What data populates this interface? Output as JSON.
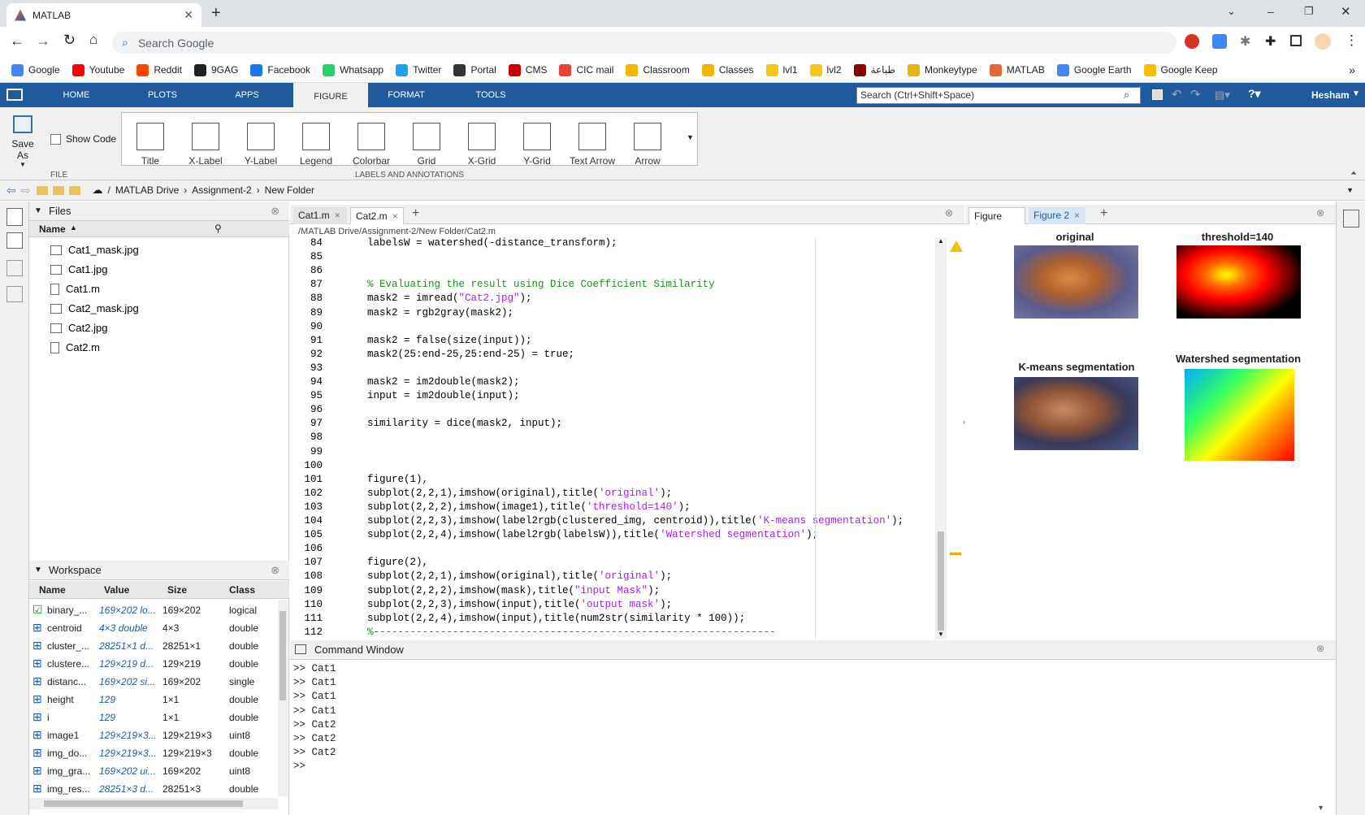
{
  "browser": {
    "tab_title": "MATLAB",
    "search_placeholder": "Search Google",
    "bookmarks": [
      {
        "label": "Google",
        "color": "#4285f4"
      },
      {
        "label": "Youtube",
        "color": "#ff0000"
      },
      {
        "label": "Reddit",
        "color": "#ff4500"
      },
      {
        "label": "9GAG",
        "color": "#222222"
      },
      {
        "label": "Facebook",
        "color": "#1877f2"
      },
      {
        "label": "Whatsapp",
        "color": "#25d366"
      },
      {
        "label": "Twitter",
        "color": "#1da1f2"
      },
      {
        "label": "Portal",
        "color": "#333333"
      },
      {
        "label": "CMS",
        "color": "#cc0000"
      },
      {
        "label": "CIC mail",
        "color": "#ea4335"
      },
      {
        "label": "Classroom",
        "color": "#f4b400"
      },
      {
        "label": "Classes",
        "color": "#f4b400"
      },
      {
        "label": "lvl1",
        "color": "#f5c518"
      },
      {
        "label": "lvl2",
        "color": "#f5c518"
      },
      {
        "label": "طباعة",
        "color": "#8b0000"
      },
      {
        "label": "Monkeytype",
        "color": "#e2b714"
      },
      {
        "label": "MATLAB",
        "color": "#e16737"
      },
      {
        "label": "Google Earth",
        "color": "#4285f4"
      },
      {
        "label": "Google Keep",
        "color": "#fbbc04"
      }
    ]
  },
  "matlab": {
    "tabs": [
      "HOME",
      "PLOTS",
      "APPS",
      "FIGURE",
      "FORMAT",
      "TOOLS"
    ],
    "active_tab": "FIGURE",
    "search_placeholder": "Search (Ctrl+Shift+Space)",
    "user": "Hesham",
    "file_group": {
      "save_as": "Save As",
      "show_code": "Show Code",
      "label": "FILE"
    },
    "labels_group": {
      "label": "LABELS AND ANNOTATIONS",
      "buttons": [
        "Title",
        "X-Label",
        "Y-Label",
        "Legend",
        "Colorbar",
        "Grid",
        "X-Grid",
        "Y-Grid",
        "Text Arrow",
        "Arrow"
      ]
    },
    "path": [
      "/",
      "MATLAB Drive",
      "Assignment-2",
      "New Folder"
    ],
    "files": {
      "title": "Files",
      "column_name": "Name",
      "items": [
        "Cat1_mask.jpg",
        "Cat1.jpg",
        "Cat1.m",
        "Cat2_mask.jpg",
        "Cat2.jpg",
        "Cat2.m"
      ]
    },
    "workspace": {
      "title": "Workspace",
      "columns": [
        "Name",
        "Value",
        "Size",
        "Class"
      ],
      "rows": [
        {
          "name": "binary_...",
          "value": "169×202 lo...",
          "size": "169×202",
          "class": "logical"
        },
        {
          "name": "centroid",
          "value": "4×3 double",
          "size": "4×3",
          "class": "double"
        },
        {
          "name": "cluster_...",
          "value": "28251×1 d...",
          "size": "28251×1",
          "class": "double"
        },
        {
          "name": "clustere...",
          "value": "129×219 d...",
          "size": "129×219",
          "class": "double"
        },
        {
          "name": "distanc...",
          "value": "169×202 si...",
          "size": "169×202",
          "class": "single"
        },
        {
          "name": "height",
          "value": "129",
          "size": "1×1",
          "class": "double"
        },
        {
          "name": "i",
          "value": "129",
          "size": "1×1",
          "class": "double"
        },
        {
          "name": "image1",
          "value": "129×219×3...",
          "size": "129×219×3",
          "class": "uint8"
        },
        {
          "name": "img_do...",
          "value": "129×219×3...",
          "size": "129×219×3",
          "class": "double"
        },
        {
          "name": "img_gra...",
          "value": "169×202 ui...",
          "size": "169×202",
          "class": "uint8"
        },
        {
          "name": "img_res...",
          "value": "28251×3 d...",
          "size": "28251×3",
          "class": "double"
        }
      ]
    },
    "editor": {
      "tabs": [
        "Cat1.m",
        "Cat2.m"
      ],
      "active_tab": "Cat2.m",
      "path": "/MATLAB Drive/Assignment-2/New Folder/Cat2.m",
      "lines": [
        {
          "n": "84",
          "segs": [
            [
              "",
              "labelsW = watershed(-distance_transform);"
            ]
          ]
        },
        {
          "n": "85",
          "segs": []
        },
        {
          "n": "86",
          "segs": []
        },
        {
          "n": "87",
          "segs": [
            [
              "cm",
              "% Evaluating the result using Dice Coefficient Similarity"
            ]
          ]
        },
        {
          "n": "88",
          "segs": [
            [
              "",
              "mask2 = imread("
            ],
            [
              "st",
              "\"Cat2.jpg\""
            ],
            [
              "",
              ");"
            ]
          ]
        },
        {
          "n": "89",
          "segs": [
            [
              "",
              "mask2 = rgb2gray(mask2);"
            ]
          ]
        },
        {
          "n": "90",
          "segs": []
        },
        {
          "n": "91",
          "segs": [
            [
              "",
              "mask2 = false(size(input));"
            ]
          ]
        },
        {
          "n": "92",
          "segs": [
            [
              "",
              "mask2(25:end-25,25:end-25) = true;"
            ]
          ]
        },
        {
          "n": "93",
          "segs": []
        },
        {
          "n": "94",
          "segs": [
            [
              "",
              "mask2 = im2double(mask2);"
            ]
          ]
        },
        {
          "n": "95",
          "segs": [
            [
              "",
              "input = im2double(input);"
            ]
          ]
        },
        {
          "n": "96",
          "segs": []
        },
        {
          "n": "97",
          "segs": [
            [
              "",
              "similarity = dice(mask2, input);"
            ]
          ]
        },
        {
          "n": "98",
          "segs": []
        },
        {
          "n": "99",
          "segs": []
        },
        {
          "n": "100",
          "segs": []
        },
        {
          "n": "101",
          "segs": [
            [
              "",
              "figure(1),"
            ]
          ]
        },
        {
          "n": "102",
          "segs": [
            [
              "",
              "subplot(2,2,1),imshow(original),title("
            ],
            [
              "st",
              "'original'"
            ],
            [
              "",
              ");"
            ]
          ]
        },
        {
          "n": "103",
          "segs": [
            [
              "",
              "subplot(2,2,2),imshow(image1),title("
            ],
            [
              "st",
              "'threshold=140'"
            ],
            [
              "",
              ");"
            ]
          ]
        },
        {
          "n": "104",
          "segs": [
            [
              "",
              "subplot(2,2,3),imshow(label2rgb(clustered_img, centroid)),title("
            ],
            [
              "st",
              "'K-means segmentation'"
            ],
            [
              "",
              ");"
            ]
          ]
        },
        {
          "n": "105",
          "segs": [
            [
              "",
              "subplot(2,2,4),imshow(label2rgb(labelsW)),title("
            ],
            [
              "st",
              "'Watershed segmentation'"
            ],
            [
              "",
              ");"
            ]
          ]
        },
        {
          "n": "106",
          "segs": []
        },
        {
          "n": "107",
          "segs": [
            [
              "",
              "figure(2),"
            ]
          ]
        },
        {
          "n": "108",
          "segs": [
            [
              "",
              "subplot(2,2,1),imshow(original),title("
            ],
            [
              "st",
              "'original'"
            ],
            [
              "",
              ");"
            ]
          ]
        },
        {
          "n": "109",
          "segs": [
            [
              "",
              "subplot(2,2,2),imshow(mask),title("
            ],
            [
              "st",
              "\"input Mask\""
            ],
            [
              "",
              ");"
            ]
          ]
        },
        {
          "n": "110",
          "segs": [
            [
              "",
              "subplot(2,2,3),imshow(input),title("
            ],
            [
              "st",
              "'output mask'"
            ],
            [
              "",
              ");"
            ]
          ]
        },
        {
          "n": "111",
          "segs": [
            [
              "",
              "subplot(2,2,4),imshow(input),title(num2str(similarity * 100));"
            ]
          ]
        },
        {
          "n": "112",
          "segs": [
            [
              "cm",
              "%------------------------------------------------------------------"
            ]
          ]
        }
      ]
    },
    "figures": {
      "tabs": [
        "Figure 1",
        "Figure 2"
      ],
      "active_tab": "Figure 1",
      "subplots": [
        "original",
        "threshold=140",
        "K-means segmentation",
        "Watershed segmentation"
      ]
    },
    "command_window": {
      "title": "Command Window",
      "lines": [
        ">> Cat1",
        ">> Cat1",
        ">> Cat1",
        ">> Cat1",
        ">> Cat2",
        ">> Cat2",
        ">> Cat2",
        ">>"
      ]
    }
  }
}
